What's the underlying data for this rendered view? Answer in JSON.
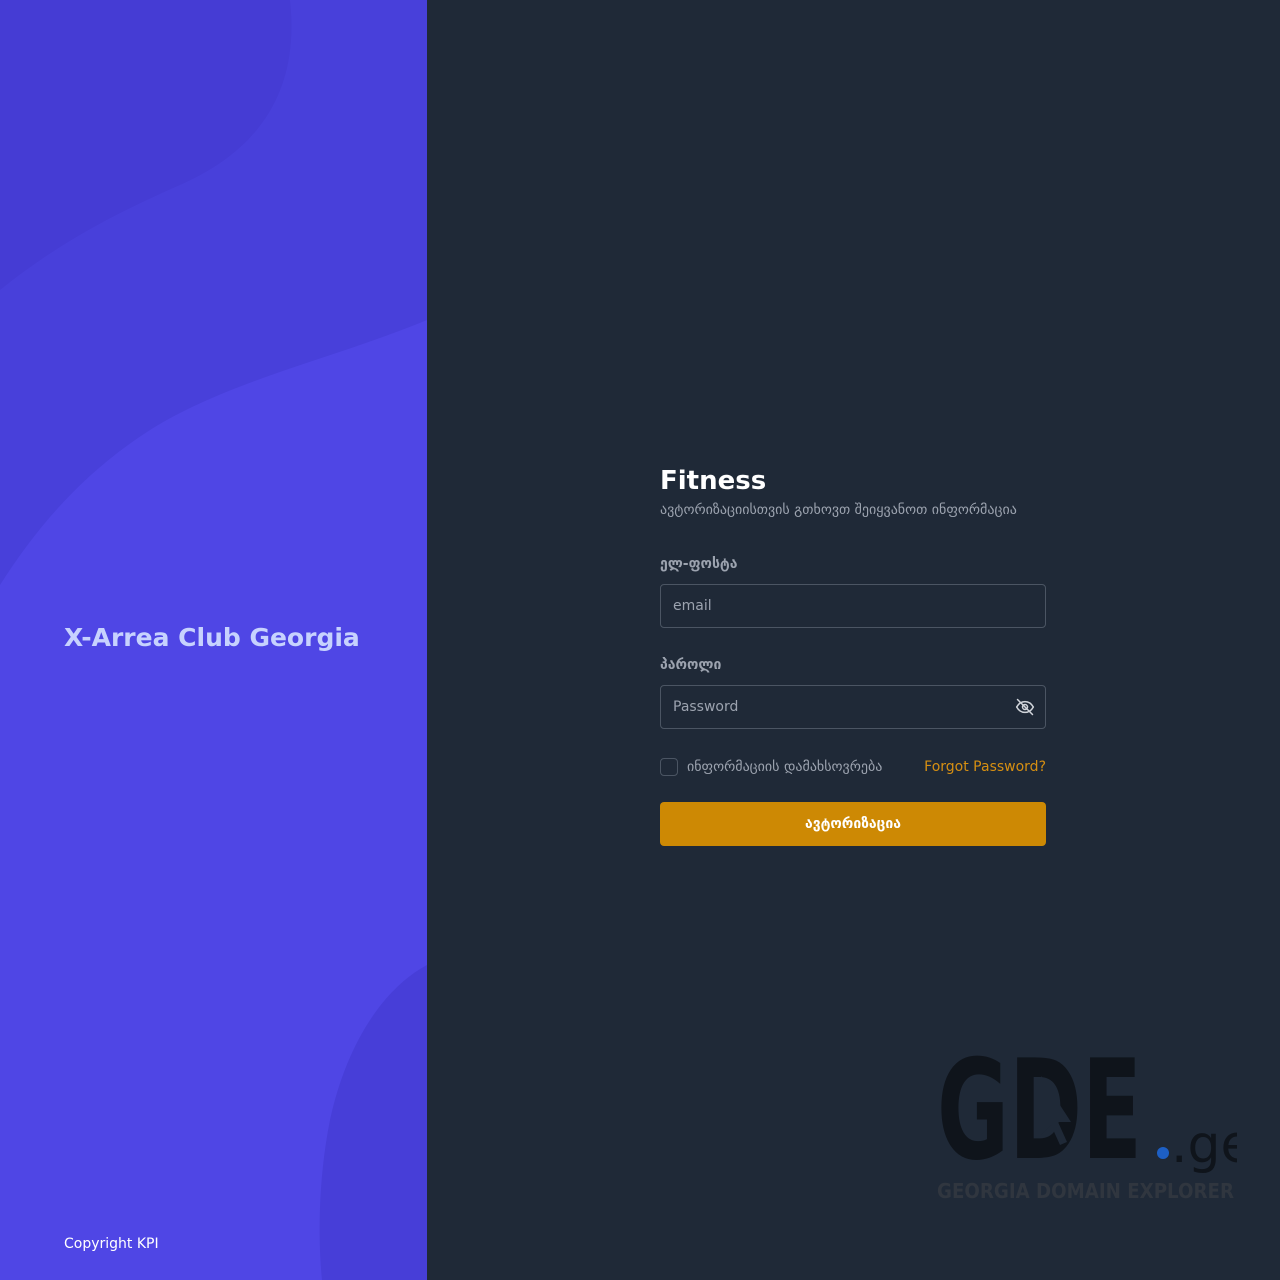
{
  "brand": {
    "name": "X-Arrea Club Georgia",
    "copyright": "Copyright KPI"
  },
  "login": {
    "title": "Fitness",
    "subtitle": "ავტორიზაციისთვის გთხოვთ შეიყვანოთ ინფორმაცია",
    "email_label": "ელ-ფოსტა",
    "email_placeholder": "email",
    "password_label": "პაროლი",
    "password_placeholder": "Password",
    "remember_label": "ინფორმაციის დამახსოვრება",
    "forgot_label": "Forgot Password?",
    "submit_label": "ავტორიზაცია",
    "password_toggle_icon": "eye-slash-icon"
  },
  "watermark": {
    "logo_text": "GDE",
    "logo_suffix": ".ge",
    "tagline": "GEORGIA DOMAIN EXPLORER"
  },
  "colors": {
    "left_panel": "#4f46e5",
    "right_panel": "#1f2937",
    "accent": "#cd8904",
    "link": "#d68f12"
  }
}
